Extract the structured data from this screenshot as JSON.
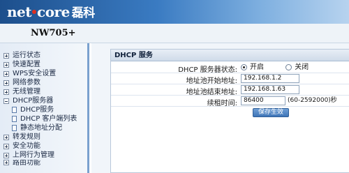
{
  "header": {
    "logo_text": "net",
    "logo_text2": "core",
    "logo_cn": "磊科"
  },
  "model": "NW705+",
  "sidebar": {
    "items": [
      {
        "label": "运行状态"
      },
      {
        "label": "快速配置"
      },
      {
        "label": "WPS安全设置"
      },
      {
        "label": "网络参数"
      },
      {
        "label": "无线管理"
      },
      {
        "label": "DHCP服务器"
      },
      {
        "label": "DHCP服务"
      },
      {
        "label": "DHCP 客户端列表"
      },
      {
        "label": "静态地址分配"
      },
      {
        "label": "转发规则"
      },
      {
        "label": "安全功能"
      },
      {
        "label": "上网行为管理"
      },
      {
        "label": "路由功能"
      }
    ]
  },
  "panel": {
    "title": "DHCP 服务",
    "dhcp_status_label": "DHCP 服务器状态:",
    "option_on": "开启",
    "option_off": "关闭",
    "start_label": "地址池开始地址:",
    "start_value": "192.168.1.2",
    "end_label": "地址池结束地址:",
    "end_value": "192.168.1.63",
    "lease_label": "续租时间:",
    "lease_value": "86400",
    "lease_hint": "(60-2592000)秒",
    "save_button": "保存生效"
  }
}
